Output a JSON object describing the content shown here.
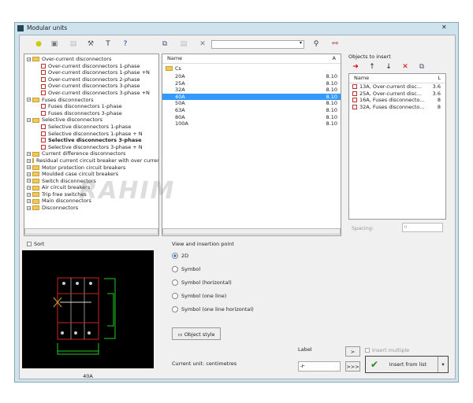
{
  "window": {
    "title": "Modular units"
  },
  "toolbar": {
    "search_value": ""
  },
  "tree": [
    {
      "label": "Over-current disconnectors",
      "type": "folder"
    },
    {
      "label": "Over-current disconnectors 1-phase",
      "type": "item"
    },
    {
      "label": "Over-current disconnectors 1-phase +N",
      "type": "item"
    },
    {
      "label": "Over-current disconnectors 2-phase",
      "type": "item"
    },
    {
      "label": "Over-current disconnectors 3-phase",
      "type": "item"
    },
    {
      "label": "Over-current disconnectors 3-phase +N",
      "type": "item"
    },
    {
      "label": "Fuses disconnectors",
      "type": "folder"
    },
    {
      "label": "Fuses disconnectors 1-phase",
      "type": "item"
    },
    {
      "label": "Fuses disconnectors 3-phase",
      "type": "item"
    },
    {
      "label": "Selective disconnectors",
      "type": "folder"
    },
    {
      "label": "Selective disconnectors 1-phase",
      "type": "item"
    },
    {
      "label": "Selective disconnectors 1-phase + N",
      "type": "item"
    },
    {
      "label": "Selective disconnectors 3-phase",
      "type": "item",
      "bold": true
    },
    {
      "label": "Selective disconnectors 3-phase + N",
      "type": "item"
    },
    {
      "label": "Current difference disconnectors",
      "type": "folder"
    },
    {
      "label": "Residual current circuit breaker with over current",
      "type": "folder"
    },
    {
      "label": "Motor protection circuit breakers",
      "type": "folder"
    },
    {
      "label": "Moulded case circuit breakers",
      "type": "folder"
    },
    {
      "label": "Switch disconnectors",
      "type": "folder"
    },
    {
      "label": "Air circuit breakers",
      "type": "folder"
    },
    {
      "label": "Trip free switches",
      "type": "folder"
    },
    {
      "label": "Main disconnectors",
      "type": "folder"
    },
    {
      "label": "Disconnectors",
      "type": "folder"
    }
  ],
  "list": {
    "col_name": "Name",
    "col_a": "A",
    "folder": "Cs",
    "rows": [
      {
        "name": "20A",
        "a": "8.10"
      },
      {
        "name": "25A",
        "a": "8.10"
      },
      {
        "name": "32A",
        "a": "8.10"
      },
      {
        "name": "40A",
        "a": "8.10",
        "selected": true
      },
      {
        "name": "50A",
        "a": "8.10"
      },
      {
        "name": "63A",
        "a": "8.10"
      },
      {
        "name": "80A",
        "a": "8.10"
      },
      {
        "name": "100A",
        "a": "8.10"
      }
    ]
  },
  "objects": {
    "title": "Objects to insert",
    "col_name": "Name",
    "col_l": "L",
    "rows": [
      {
        "name": "13A, Over-current disc...",
        "l": "3.6"
      },
      {
        "name": "25A, Over-current disc...",
        "l": "3.6"
      },
      {
        "name": "16A, Fuses disconnecto...",
        "l": "8"
      },
      {
        "name": "32A, Fuses disconnecto...",
        "l": "8"
      }
    ],
    "spacing_label": "Spacing:",
    "spacing_value": "0"
  },
  "sort_label": "Sort",
  "preview_caption": "40A",
  "view": {
    "title": "View and insertion point",
    "options": [
      "2D",
      "Symbol",
      "Symbol (horizontal)",
      "Symbol (one line)",
      "Symbol (one line horizontal)"
    ],
    "selected": 0,
    "object_style": "Object style"
  },
  "current_unit": "Current unit: centimetres",
  "label": {
    "title": "Label",
    "value": "-F",
    "btn1": ">",
    "btn2": ">>>"
  },
  "insert_multiple": "Insert multiple",
  "insert_button": "Insert from list",
  "watermark": "RAHIM SOFTWARES"
}
